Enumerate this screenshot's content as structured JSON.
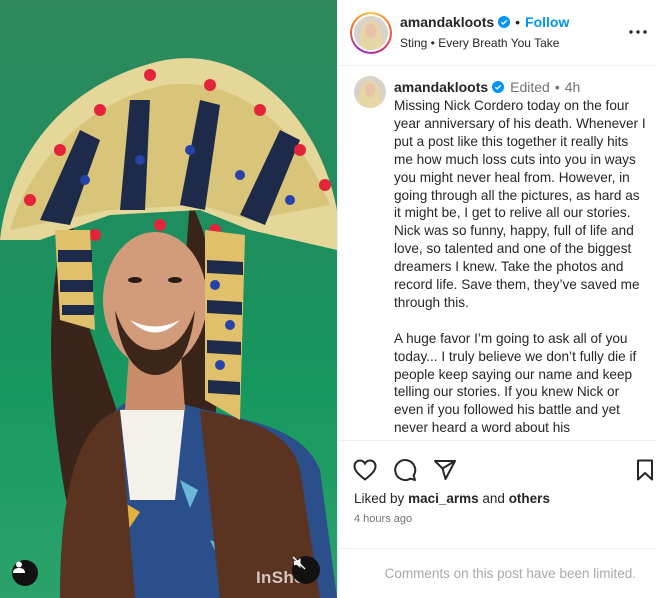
{
  "post": {
    "username": "amandakloots",
    "follow_label": "Follow",
    "audio": "Sting • Every Breath You Take",
    "edited_label": "Edited",
    "time_short": "4h",
    "caption_paragraphs": [
      "Missing Nick Cordero today on the four year anniversary of his death. Whenever I put a post like this together it really hits me how much loss cuts into you in ways you might never heal from. However, in going through all the pictures, as hard as it might be, I get to relive all our stories. Nick was so funny, happy, full of life and love, so talented and one of the biggest dreamers I knew. Take the photos and record life. Save them, they’ve saved me through this.",
      "A huge favor I’m going to ask all of you today... I truly believe we don’t fully die if people keep saying our name and keep telling our stories. If you knew Nick or even if you followed his battle and yet never heard a word about his"
    ],
    "liked_prefix": "Liked by",
    "liked_user": "maci_arms",
    "liked_and": "and",
    "liked_others": "others",
    "time_ago": "4 hours ago",
    "comments_limited": "Comments on this post have been limited."
  },
  "media": {
    "watermark": "InShot"
  },
  "icons": {
    "verified": "verified-badge-icon",
    "more": "more-options-icon",
    "like": "heart-icon",
    "comment": "comment-icon",
    "share": "share-icon",
    "save": "bookmark-icon",
    "tag": "user-tag-icon",
    "mute": "mute-icon"
  },
  "colors": {
    "follow": "#0095f6",
    "verified": "#0095f6",
    "muted_text": "#737373",
    "limited_text": "#a8a8a8",
    "green_screen": "#1f8d5e"
  }
}
